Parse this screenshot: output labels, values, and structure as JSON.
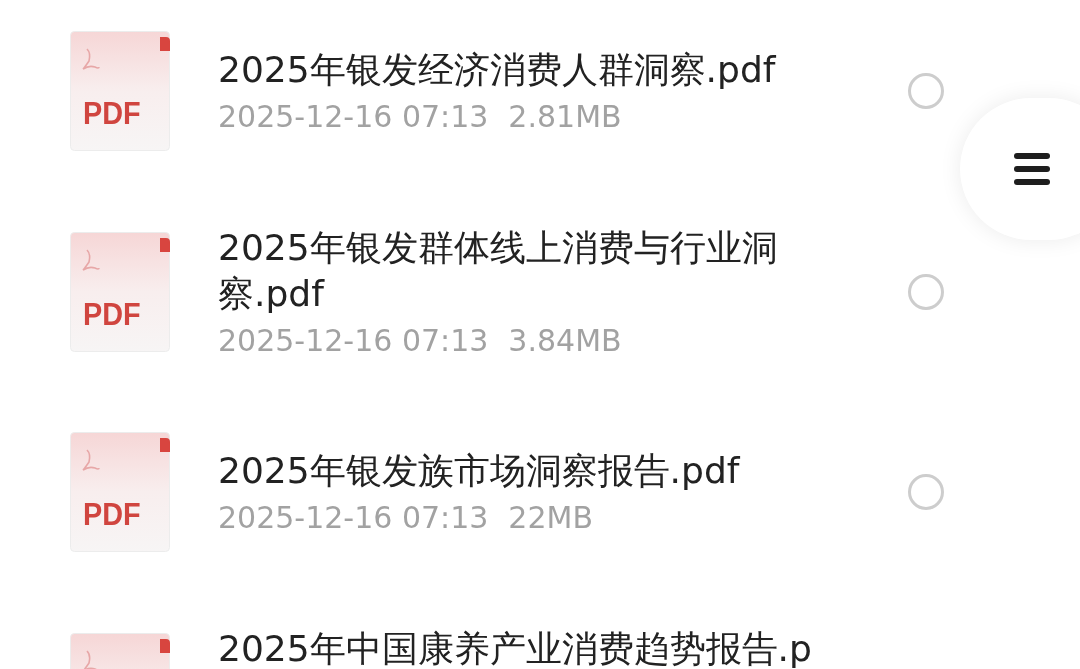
{
  "files": [
    {
      "name": "2025年银发经济消费人群洞察.pdf",
      "date": "2025-12-16 07:13",
      "size": "2.81MB",
      "selected": false,
      "icon_label": "PDF"
    },
    {
      "name": "2025年银发群体线上消费与行业洞察.pdf",
      "date": "2025-12-16 07:13",
      "size": "3.84MB",
      "selected": false,
      "icon_label": "PDF"
    },
    {
      "name": "2025年银发族市场洞察报告.pdf",
      "date": "2025-12-16 07:13",
      "size": "22MB",
      "selected": false,
      "icon_label": "PDF"
    },
    {
      "name": "2025年中国康养产业消费趋势报告.p"
    }
  ]
}
